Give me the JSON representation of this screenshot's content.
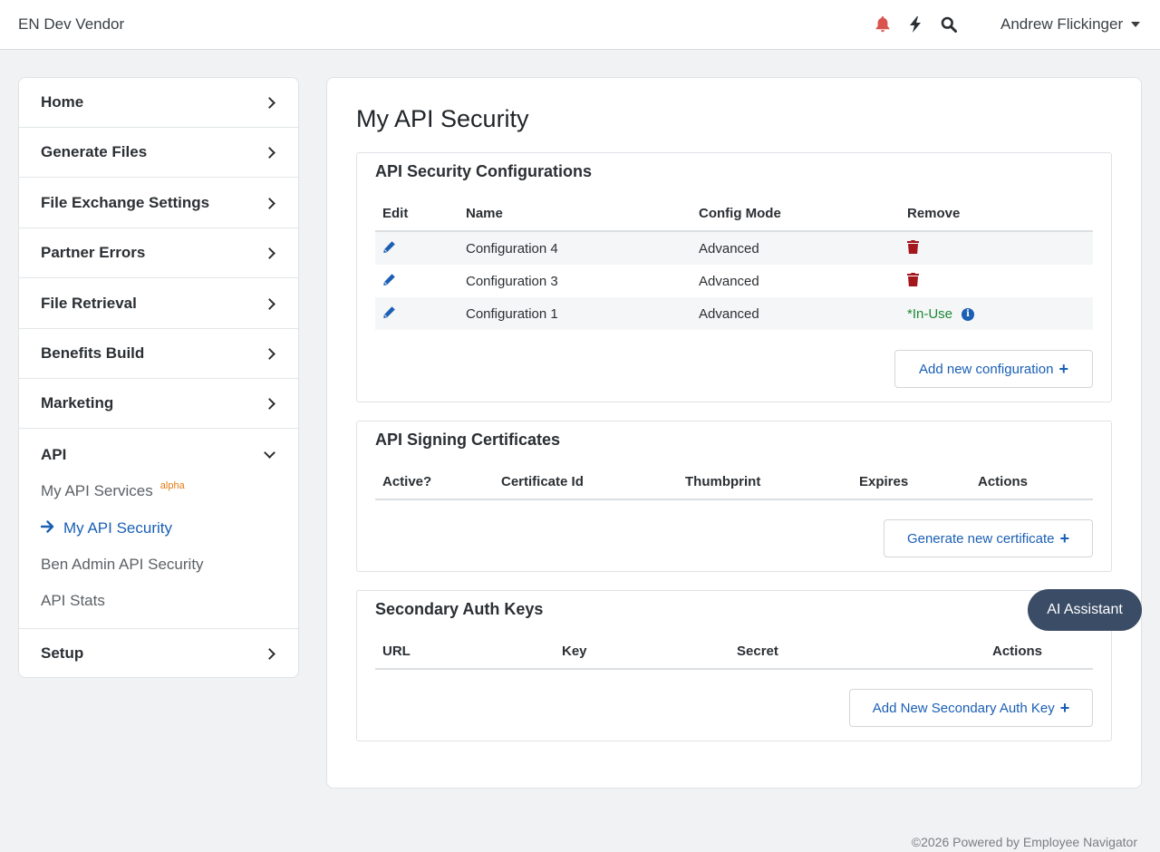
{
  "header": {
    "brand": "EN Dev Vendor",
    "icons": [
      "bell-icon",
      "bolt-icon",
      "search-icon"
    ],
    "user": "Andrew Flickinger"
  },
  "sidebar": {
    "items": [
      {
        "label": "Home"
      },
      {
        "label": "Generate Files"
      },
      {
        "label": "File Exchange Settings"
      },
      {
        "label": "Partner Errors"
      },
      {
        "label": "File Retrieval"
      },
      {
        "label": "Benefits Build"
      },
      {
        "label": "Marketing"
      },
      {
        "label": "API"
      },
      {
        "label": "Setup"
      }
    ],
    "api_sub": [
      {
        "label": "My API Services",
        "badge": "alpha"
      },
      {
        "label": "My API Security"
      },
      {
        "label": "Ben Admin API Security"
      },
      {
        "label": "API Stats"
      }
    ]
  },
  "main": {
    "title": "My API Security",
    "configs": {
      "title": "API Security Configurations",
      "headers": [
        "Edit",
        "Name",
        "Config Mode",
        "Remove"
      ],
      "rows": [
        {
          "name": "Configuration 4",
          "mode": "Advanced",
          "remove": "trash"
        },
        {
          "name": "Configuration 3",
          "mode": "Advanced",
          "remove": "trash"
        },
        {
          "name": "Configuration 1",
          "mode": "Advanced",
          "remove": "*In-Use"
        }
      ],
      "add_label": "Add new configuration"
    },
    "certs": {
      "title": "API Signing Certificates",
      "headers": [
        "Active?",
        "Certificate Id",
        "Thumbprint",
        "Expires",
        "Actions"
      ],
      "add_label": "Generate new certificate"
    },
    "secondary": {
      "title": "Secondary Auth Keys",
      "headers": [
        "URL",
        "Key",
        "Secret",
        "Actions"
      ],
      "add_label": "Add New Secondary Auth Key"
    }
  },
  "ai_button": "AI Assistant",
  "footer": "©2026 Powered by Employee Navigator",
  "colors": {
    "accent": "#1a5fb4",
    "danger": "#a3161c",
    "success": "#1a8a35",
    "bell": "#d9534f",
    "ai_button": "#3b4c66"
  }
}
